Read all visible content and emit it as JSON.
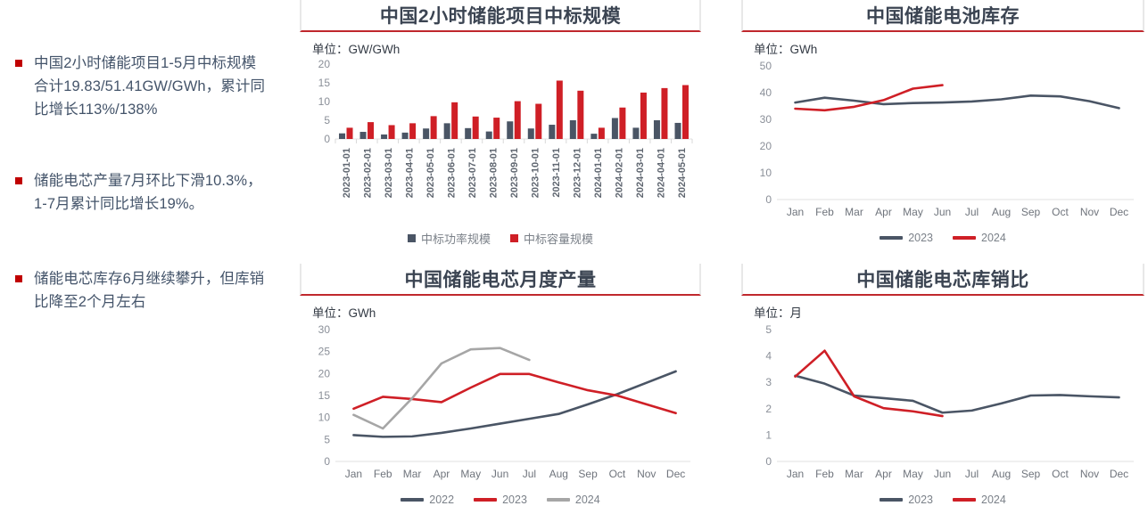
{
  "bullets": [
    {
      "text": "中国2小时储能项目1-5月中标规模合计19.83/51.41GW/GWh，累计同比增长113%/138%"
    },
    {
      "text": "储能电芯产量7月环比下滑10.3%，1-7月累计同比增长19%。"
    },
    {
      "text": "储能电芯库存6月继续攀升，但库销比降至2个月左右"
    }
  ],
  "colors": {
    "red": "#cf1f26",
    "gray": "#4a5565",
    "light_gray": "#a6a6a6",
    "bullet_marker": "#c00000",
    "title_text": "#3b4452",
    "title_rule": "#c0282d"
  },
  "chart_data": [
    {
      "id": "bid-scale",
      "type": "bar",
      "title": "中国2小时储能项目中标规模",
      "unit_label": "单位：GW/GWh",
      "ylabel": "",
      "xlabel": "",
      "ylim": [
        0,
        20
      ],
      "yticks": [
        0,
        5,
        10,
        15,
        20
      ],
      "grid": false,
      "legend_position": "bottom",
      "categories": [
        "2023-01-01",
        "2023-02-01",
        "2023-03-01",
        "2023-04-01",
        "2023-05-01",
        "2023-06-01",
        "2023-07-01",
        "2023-08-01",
        "2023-09-01",
        "2023-10-01",
        "2023-11-01",
        "2023-12-01",
        "2024-01-01",
        "2024-02-01",
        "2024-03-01",
        "2024-04-01",
        "2024-05-01"
      ],
      "series": [
        {
          "name": "中标功率规模",
          "color": "#4a5565",
          "values": [
            1.5,
            1.9,
            1.2,
            1.7,
            2.8,
            4.2,
            2.9,
            2.0,
            4.7,
            2.8,
            3.8,
            5.0,
            1.4,
            5.6,
            3.0,
            5.0,
            4.3
          ]
        },
        {
          "name": "中标容量规模",
          "color": "#cf1f26",
          "values": [
            3.0,
            4.5,
            3.7,
            4.2,
            6.1,
            9.8,
            6.0,
            5.7,
            10.1,
            9.4,
            15.6,
            12.9,
            3.0,
            8.4,
            12.4,
            13.6,
            14.4
          ]
        }
      ]
    },
    {
      "id": "battery-inventory",
      "type": "line",
      "title": "中国储能电池库存",
      "unit_label": "单位：GWh",
      "ylabel": "",
      "xlabel": "",
      "ylim": [
        0,
        50
      ],
      "yticks": [
        0,
        10,
        20,
        30,
        40,
        50
      ],
      "grid": false,
      "legend_position": "bottom",
      "categories": [
        "Jan",
        "Feb",
        "Mar",
        "Apr",
        "May",
        "Jun",
        "Jul",
        "Aug",
        "Sep",
        "Oct",
        "Nov",
        "Dec"
      ],
      "series": [
        {
          "name": "2023",
          "color": "#4a5565",
          "values": [
            36.3,
            38.1,
            37.0,
            35.7,
            36.1,
            36.3,
            36.7,
            37.5,
            38.9,
            38.6,
            36.8,
            34.2
          ]
        },
        {
          "name": "2024",
          "color": "#cf1f26",
          "values": [
            34.0,
            33.4,
            34.7,
            37.2,
            41.5,
            42.8,
            null,
            null,
            null,
            null,
            null,
            null
          ]
        }
      ]
    },
    {
      "id": "cell-production",
      "type": "line",
      "title": "中国储能电芯月度产量",
      "unit_label": "单位：GWh",
      "ylabel": "",
      "xlabel": "",
      "ylim": [
        0,
        30
      ],
      "yticks": [
        0,
        5,
        10,
        15,
        20,
        25,
        30
      ],
      "grid": false,
      "legend_position": "bottom",
      "categories": [
        "Jan",
        "Feb",
        "Mar",
        "Apr",
        "May",
        "Jun",
        "Jul",
        "Aug",
        "Sep",
        "Oct",
        "Nov",
        "Dec"
      ],
      "series": [
        {
          "name": "2022",
          "color": "#4a5565",
          "values": [
            6.0,
            5.6,
            5.7,
            6.5,
            7.5,
            8.6,
            9.7,
            10.8,
            13.0,
            15.3,
            17.9,
            20.5
          ]
        },
        {
          "name": "2023",
          "color": "#cf1f26",
          "values": [
            12.0,
            14.7,
            14.2,
            13.5,
            16.8,
            19.9,
            19.9,
            18.0,
            16.2,
            15.0,
            13.0,
            11.0
          ]
        },
        {
          "name": "2024",
          "color": "#a6a6a6",
          "values": [
            10.6,
            7.5,
            14.4,
            22.3,
            25.5,
            25.8,
            23.1,
            null,
            null,
            null,
            null,
            null
          ]
        }
      ]
    },
    {
      "id": "inventory-sales-ratio",
      "type": "line",
      "title": "中国储能电芯库销比",
      "unit_label": "单位：月",
      "ylabel": "",
      "xlabel": "",
      "ylim": [
        0,
        5
      ],
      "yticks": [
        0,
        1,
        2,
        3,
        4,
        5
      ],
      "grid": false,
      "legend_position": "bottom",
      "categories": [
        "Jan",
        "Feb",
        "Mar",
        "Apr",
        "May",
        "Jun",
        "Jul",
        "Aug",
        "Sep",
        "Oct",
        "Nov",
        "Dec"
      ],
      "series": [
        {
          "name": "2023",
          "color": "#4a5565",
          "values": [
            3.25,
            2.95,
            2.5,
            2.4,
            2.3,
            1.85,
            1.93,
            2.2,
            2.5,
            2.52,
            2.47,
            2.43
          ]
        },
        {
          "name": "2024",
          "color": "#cf1f26",
          "values": [
            3.22,
            4.2,
            2.47,
            2.02,
            1.9,
            1.72,
            null,
            null,
            null,
            null,
            null,
            null
          ]
        }
      ]
    }
  ]
}
